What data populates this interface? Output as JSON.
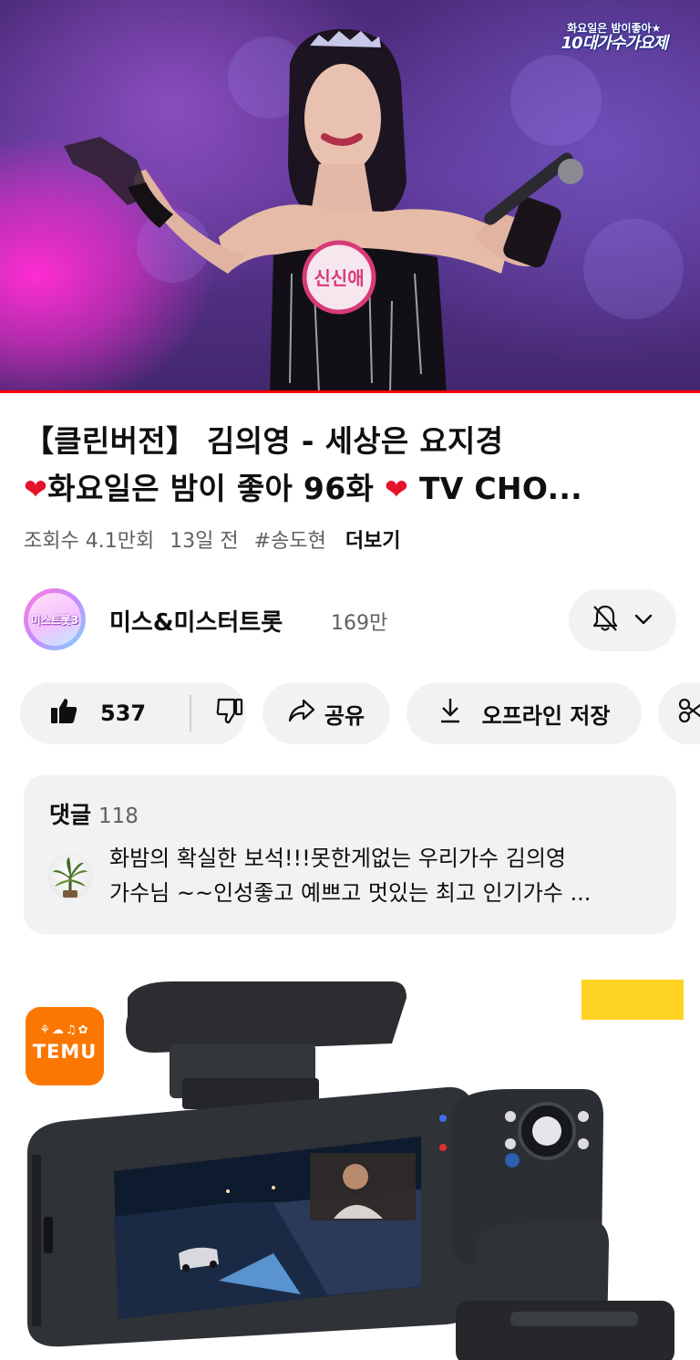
{
  "video": {
    "watermark_line1": "화요일은 밤이좋아★",
    "watermark_line2": "10대가수가요제",
    "badge_text": "신신애",
    "progress": 1.0
  },
  "title": {
    "line1": "【클린버전】 김의영 - 세상은 요지경",
    "line2_pre": "화요일은 밤이 좋아 96화 ",
    "line2_post": " TV CHO...",
    "heart": "❤"
  },
  "meta": {
    "views": "조회수 4.1만회",
    "age": "13일 전",
    "hashtag": "#송도현",
    "more": "더보기"
  },
  "channel": {
    "avatar_text": "미스트롯3",
    "name": "미스&미스터트롯",
    "subscribers": "169만",
    "bell_icon": "bell-off-icon",
    "chevron_icon": "chevron-down-icon"
  },
  "actions": {
    "like_count": "537",
    "share_label": "공유",
    "download_label": "오프라인 저장"
  },
  "comments": {
    "label": "댓글",
    "count": "118",
    "top_comment_line1": "화밤의 확실한 보석!!!못한게없는 우리가수 김의영",
    "top_comment_line2": "가수님 ~~인성좋고 예쁘고 멋있는 최고 인기가수 ..."
  },
  "ad": {
    "brand": "TEMU",
    "brand_glyphs": "⚘☁♫✿",
    "accent": "#fb7701"
  }
}
